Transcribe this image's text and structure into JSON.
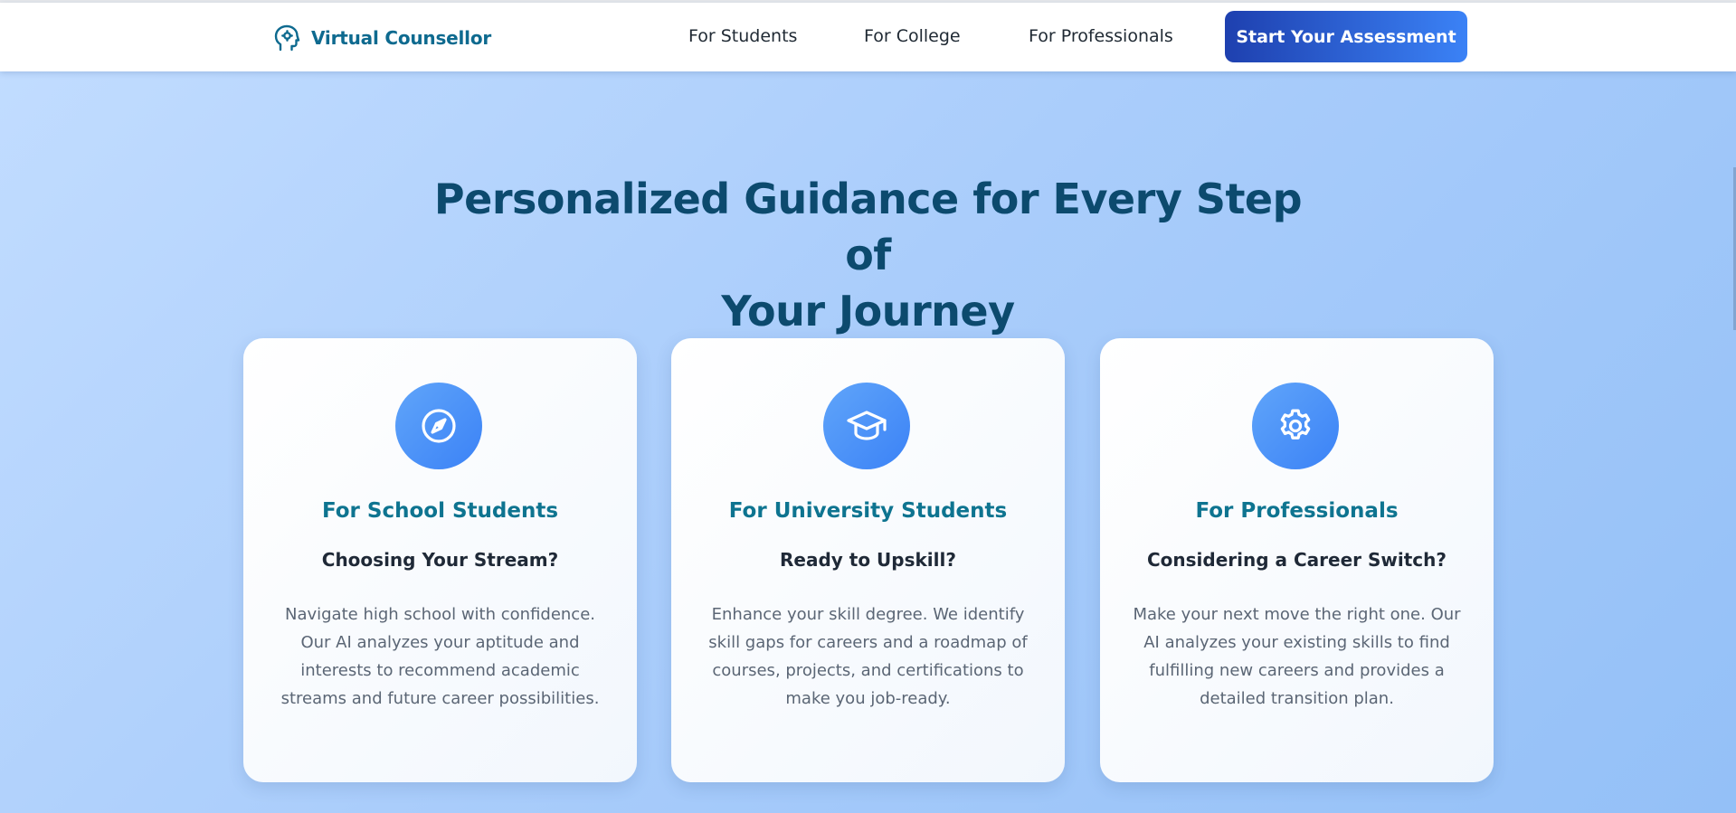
{
  "header": {
    "brand": {
      "name": "Virtual Counsellor",
      "icon": "brain-head-icon"
    },
    "nav": [
      {
        "label": "For Students"
      },
      {
        "label": "For College"
      },
      {
        "label": "For Professionals"
      }
    ],
    "cta_label": "Start Your Assessment"
  },
  "main": {
    "title_line1": "Personalized Guidance for Every Step of",
    "title_line2": "Your Journey",
    "cards": [
      {
        "icon": "compass-icon",
        "title": "For School Students",
        "subtitle": "Choosing Your Stream?",
        "description": "Navigate high school with confidence. Our AI analyzes your aptitude and interests to recommend academic streams and future career possibilities."
      },
      {
        "icon": "graduation-cap-icon",
        "title": "For University Students",
        "subtitle": "Ready to Upskill?",
        "description": "Enhance your skill degree. We identify skill gaps for careers and a roadmap of courses, projects, and certifications to make you job-ready."
      },
      {
        "icon": "gear-icon",
        "title": "For Professionals",
        "subtitle": "Considering a Career Switch?",
        "description": "Make your next move the right one. Our AI analyzes your existing skills to find fulfilling new careers and provides a detailed transition plan."
      }
    ]
  },
  "colors": {
    "brand": "#0e6a8f",
    "heading": "#0c4a6e",
    "card_title": "#0e7490",
    "cta_start": "#1e40af",
    "cta_end": "#3b82f6",
    "icon_circle": "#3b82f6"
  }
}
